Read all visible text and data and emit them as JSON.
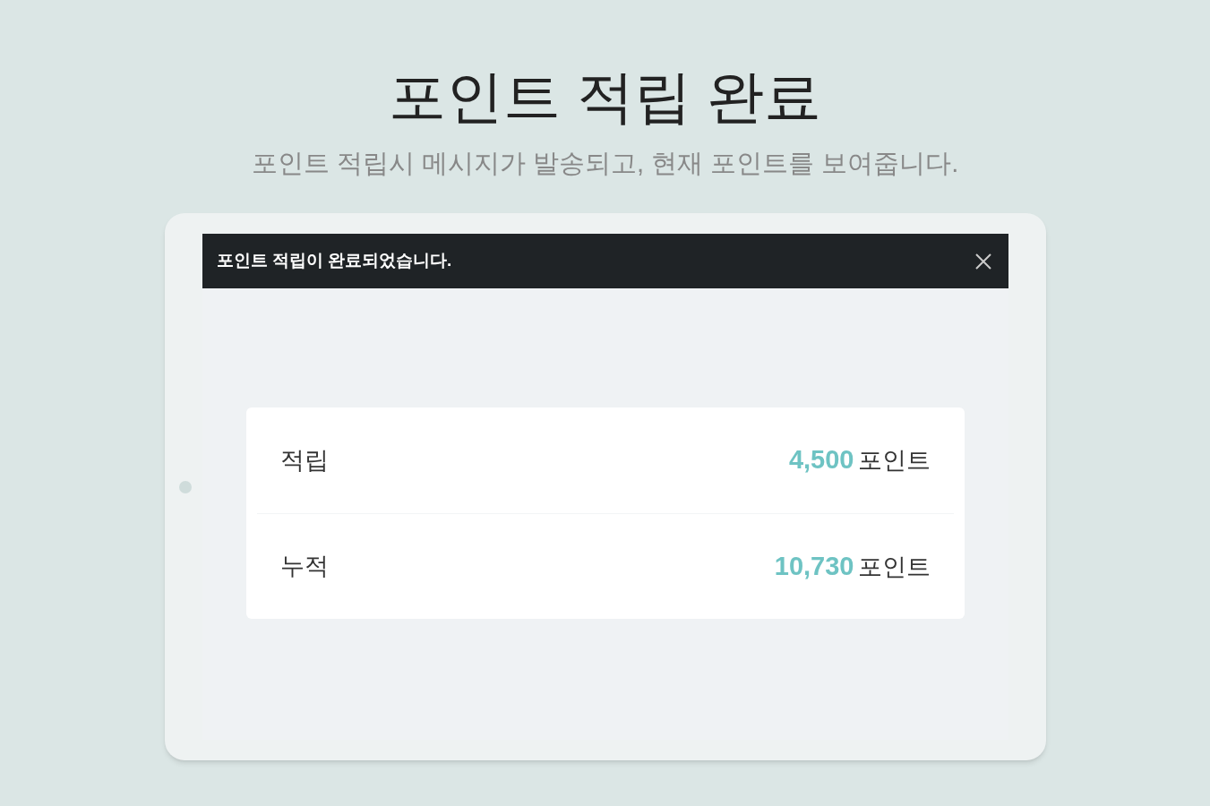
{
  "title": "포인트 적립 완료",
  "subtitle": "포인트 적립시 메시지가 발송되고, 현재 포인트를 보여줍니다.",
  "notification": {
    "message": "포인트 적립이 완료되었습니다."
  },
  "rows": [
    {
      "label": "적립",
      "amount": "4,500",
      "unit": "포인트"
    },
    {
      "label": "누적",
      "amount": "10,730",
      "unit": "포인트"
    }
  ]
}
